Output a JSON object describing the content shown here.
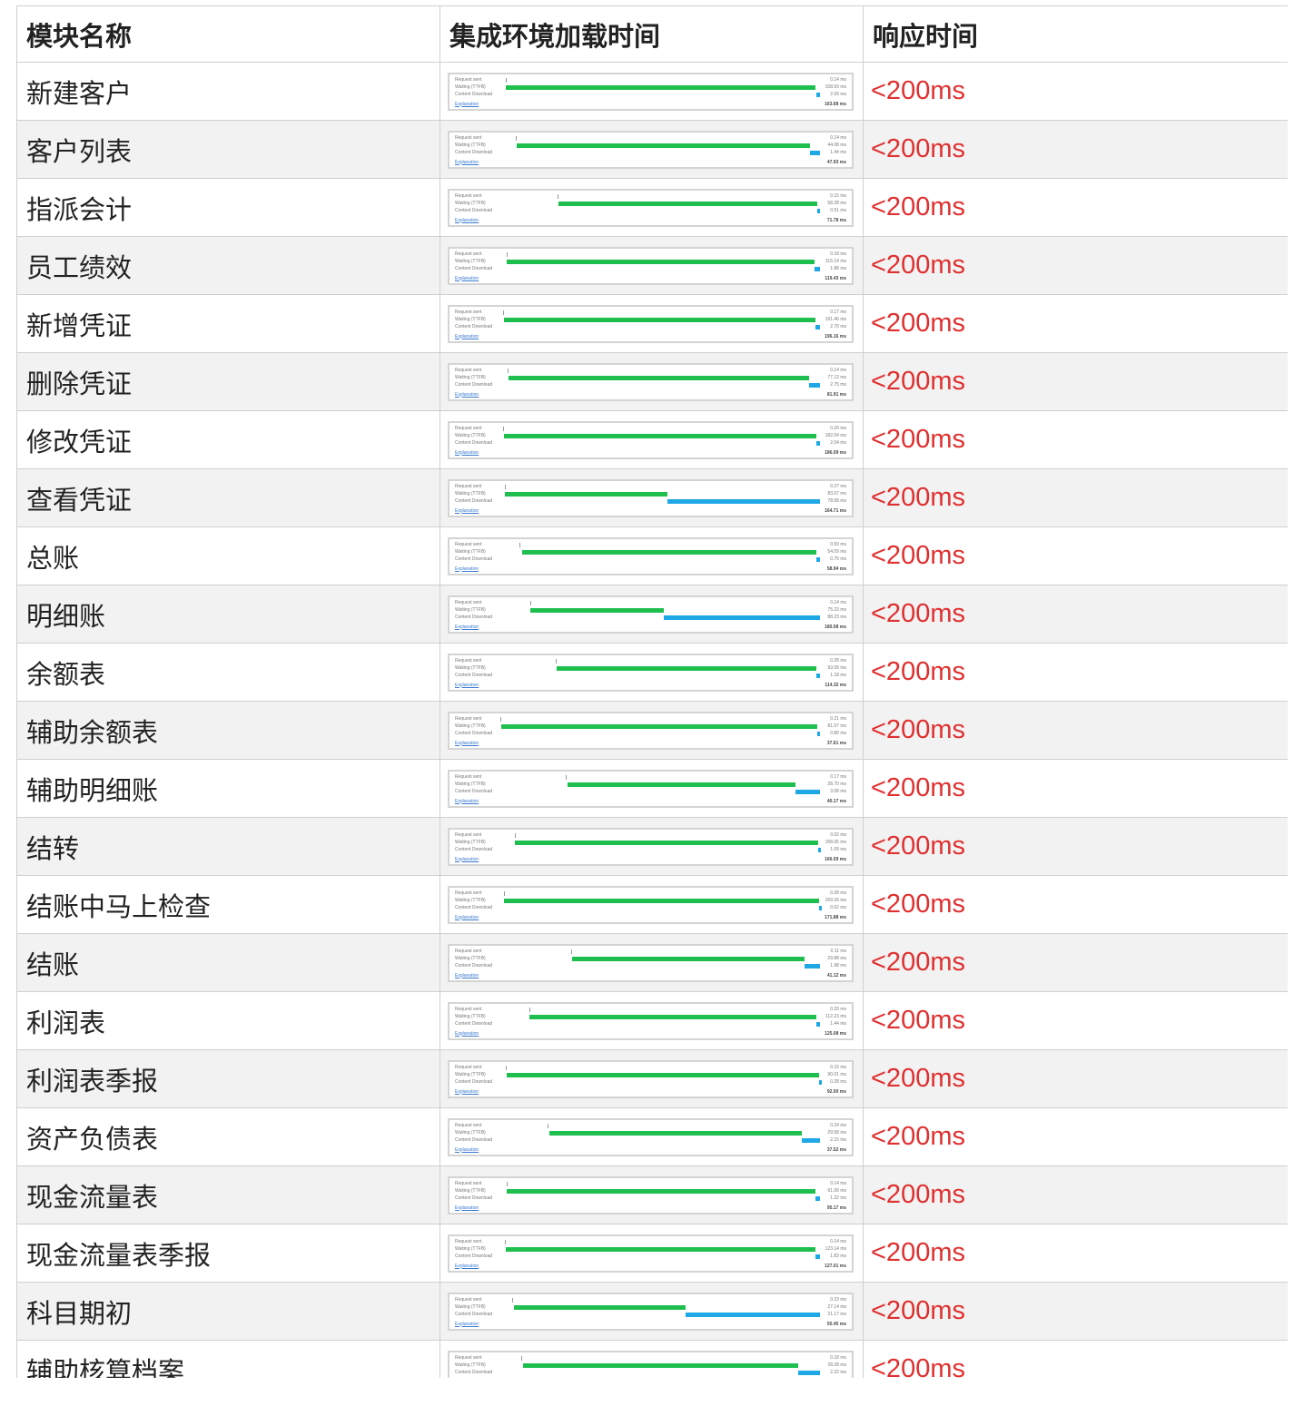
{
  "headers": {
    "name": "模块名称",
    "timing": "集成环境加载时间",
    "response": "响应时间"
  },
  "timing_labels": {
    "request": "Request sent",
    "waiting": "Waiting (TTFB)",
    "download": "Content Download",
    "explanation": "Explanation"
  },
  "colors": {
    "waiting": "#1fbf4f",
    "download": "#1ea8e6",
    "response_text": "#e03030"
  },
  "rows": [
    {
      "name": "新建客户",
      "response": "<200ms",
      "request_ms": 0.14,
      "waiting_ms": 158.59,
      "download_ms": 2.09,
      "total_ms": 163.68,
      "request_label": "0.14 ms",
      "waiting_label": "158.59 ms",
      "download_label": "2.09 ms",
      "total_label": "163.68 ms"
    },
    {
      "name": "客户列表",
      "response": "<200ms",
      "request_ms": 0.14,
      "waiting_ms": 44.08,
      "download_ms": 1.44,
      "total_ms": 47.93,
      "request_label": "0.14 ms",
      "waiting_label": "44.08 ms",
      "download_label": "1.44 ms",
      "total_label": "47.93 ms"
    },
    {
      "name": "指派会计",
      "response": "<200ms",
      "request_ms": 0.15,
      "waiting_ms": 58.28,
      "download_ms": 0.51,
      "total_ms": 71.78,
      "request_label": "0.15 ms",
      "waiting_label": "58.28 ms",
      "download_label": "0.51 ms",
      "total_label": "71.78 ms"
    },
    {
      "name": "员工绩效",
      "response": "<200ms",
      "request_ms": 0.18,
      "waiting_ms": 115.14,
      "download_ms": 1.88,
      "total_ms": 119.43,
      "request_label": "0.18 ms",
      "waiting_label": "115.14 ms",
      "download_label": "1.88 ms",
      "total_label": "119.43 ms"
    },
    {
      "name": "新增凭证",
      "response": "<200ms",
      "request_ms": 0.17,
      "waiting_ms": 191.46,
      "download_ms": 2.7,
      "total_ms": 196.16,
      "request_label": "0.17 ms",
      "waiting_label": "191.46 ms",
      "download_label": "2.70 ms",
      "total_label": "196.16 ms"
    },
    {
      "name": "删除凭证",
      "response": "<200ms",
      "request_ms": 0.14,
      "waiting_ms": 77.13,
      "download_ms": 2.75,
      "total_ms": 81.91,
      "request_label": "0.14 ms",
      "waiting_label": "77.13 ms",
      "download_label": "2.75 ms",
      "total_label": "81.91 ms"
    },
    {
      "name": "修改凭证",
      "response": "<200ms",
      "request_ms": 0.2,
      "waiting_ms": 182.04,
      "download_ms": 2.04,
      "total_ms": 186.09,
      "request_label": "0.20 ms",
      "waiting_label": "182.04 ms",
      "download_label": "2.04 ms",
      "total_label": "186.09 ms"
    },
    {
      "name": "查看凭证",
      "response": "<200ms",
      "request_ms": 0.27,
      "waiting_ms": 83.57,
      "download_ms": 78.58,
      "total_ms": 164.71,
      "request_label": "0.27 ms",
      "waiting_label": "83.57 ms",
      "download_label": "78.58 ms",
      "total_label": "164.71 ms"
    },
    {
      "name": "总账",
      "response": "<200ms",
      "request_ms": 0.5,
      "waiting_ms": 54.09,
      "download_ms": 0.75,
      "total_ms": 58.94,
      "request_label": "0.50 ms",
      "waiting_label": "54.09 ms",
      "download_label": "0.75 ms",
      "total_label": "58.94 ms"
    },
    {
      "name": "明细账",
      "response": "<200ms",
      "request_ms": 0.14,
      "waiting_ms": 75.23,
      "download_ms": 88.23,
      "total_ms": 180.58,
      "request_label": "0.14 ms",
      "waiting_label": "75.23 ms",
      "download_label": "88.23 ms",
      "total_label": "180.58 ms"
    },
    {
      "name": "余额表",
      "response": "<200ms",
      "request_ms": 0.28,
      "waiting_ms": 93.09,
      "download_ms": 1.18,
      "total_ms": 114.32,
      "request_label": "0.28 ms",
      "waiting_label": "93.09 ms",
      "download_label": "1.18 ms",
      "total_label": "114.32 ms"
    },
    {
      "name": "辅助余额表",
      "response": "<200ms",
      "request_ms": 0.21,
      "waiting_ms": 81.57,
      "download_ms": 0.8,
      "total_ms": 37.61,
      "request_label": "0.21 ms",
      "waiting_label": "81.57 ms",
      "download_label": "0.80 ms",
      "total_label": "37.61 ms"
    },
    {
      "name": "辅助明细账",
      "response": "<200ms",
      "request_ms": 0.17,
      "waiting_ms": 28.7,
      "download_ms": 3.08,
      "total_ms": 40.17,
      "request_label": "0.17 ms",
      "waiting_label": "28.70 ms",
      "download_label": "3.08 ms",
      "total_label": "40.17 ms"
    },
    {
      "name": "结转",
      "response": "<200ms",
      "request_ms": 0.02,
      "waiting_ms": 158.06,
      "download_ms": 1.09,
      "total_ms": 166.59,
      "request_label": "0.02 ms",
      "waiting_label": "158.06 ms",
      "download_label": "1.09 ms",
      "total_label": "166.59 ms"
    },
    {
      "name": "结账中马上检查",
      "response": "<200ms",
      "request_ms": 0.28,
      "waiting_ms": 169.26,
      "download_ms": 0.62,
      "total_ms": 171.88,
      "request_label": "0.28 ms",
      "waiting_label": "169.26 ms",
      "download_label": "0.62 ms",
      "total_label": "171.88 ms"
    },
    {
      "name": "结账",
      "response": "<200ms",
      "request_ms": 0.11,
      "waiting_ms": 29.88,
      "download_ms": 1.98,
      "total_ms": 41.12,
      "request_label": "0.11 ms",
      "waiting_label": "29.88 ms",
      "download_label": "1.98 ms",
      "total_label": "41.12 ms"
    },
    {
      "name": "利润表",
      "response": "<200ms",
      "request_ms": 0.2,
      "waiting_ms": 112.23,
      "download_ms": 1.44,
      "total_ms": 125.08,
      "request_label": "0.20 ms",
      "waiting_label": "112.23 ms",
      "download_label": "1.44 ms",
      "total_label": "125.08 ms"
    },
    {
      "name": "利润表季报",
      "response": "<200ms",
      "request_ms": 0.15,
      "waiting_ms": 90.01,
      "download_ms": 0.28,
      "total_ms": 92.0,
      "request_label": "0.15 ms",
      "waiting_label": "90.01 ms",
      "download_label": "0.28 ms",
      "total_label": "92.00 ms"
    },
    {
      "name": "资产负债表",
      "response": "<200ms",
      "request_ms": 0.24,
      "waiting_ms": 29.58,
      "download_ms": 2.15,
      "total_ms": 37.52,
      "request_label": "0.24 ms",
      "waiting_label": "29.58 ms",
      "download_label": "2.15 ms",
      "total_label": "37.52 ms"
    },
    {
      "name": "现金流量表",
      "response": "<200ms",
      "request_ms": 0.14,
      "waiting_ms": 91.99,
      "download_ms": 1.22,
      "total_ms": 95.17,
      "request_label": "0.14 ms",
      "waiting_label": "91.99 ms",
      "download_label": "1.22 ms",
      "total_label": "95.17 ms"
    },
    {
      "name": "现金流量表季报",
      "response": "<200ms",
      "request_ms": 0.14,
      "waiting_ms": 123.14,
      "download_ms": 1.83,
      "total_ms": 127.01,
      "request_label": "0.14 ms",
      "waiting_label": "123.14 ms",
      "download_label": "1.83 ms",
      "total_label": "127.01 ms"
    },
    {
      "name": "科目期初",
      "response": "<200ms",
      "request_ms": 0.23,
      "waiting_ms": 27.14,
      "download_ms": 21.17,
      "total_ms": 50.45,
      "request_label": "0.23 ms",
      "waiting_label": "27.14 ms",
      "download_label": "21.17 ms",
      "total_label": "50.45 ms"
    },
    {
      "name": "辅助核算档案",
      "response": "<200ms",
      "request_ms": 0.18,
      "waiting_ms": 28.28,
      "download_ms": 2.22,
      "total_ms": 32.85,
      "request_label": "0.18 ms",
      "waiting_label": "28.28 ms",
      "download_label": "2.22 ms",
      "total_label": "32.85 ms"
    }
  ]
}
